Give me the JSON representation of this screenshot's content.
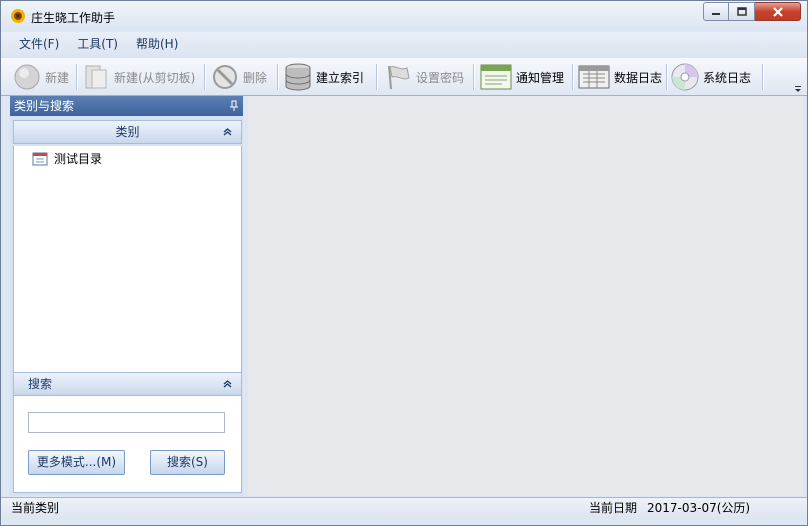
{
  "window": {
    "title": "庄生晓工作助手"
  },
  "menu": {
    "items": [
      "文件(F)",
      "工具(T)",
      "帮助(H)"
    ]
  },
  "toolbar": {
    "new_label": "新建",
    "new_from_clipboard_label": "新建(从剪切板)",
    "delete_label": "删除",
    "build_index_label": "建立索引",
    "set_password_label": "设置密码",
    "notification_label": "通知管理",
    "data_log_label": "数据日志",
    "system_log_label": "系统日志"
  },
  "left_panel": {
    "title": "类别与搜索",
    "category_header": "类别",
    "tree_items": [
      "测试目录"
    ],
    "search_header": "搜索",
    "search_value": "",
    "more_modes_label": "更多模式...(M)",
    "search_button_label": "搜索(S)"
  },
  "status": {
    "current_category_label": "当前类别",
    "current_date_label": "当前日期",
    "current_date_value": "2017-03-07(公历)"
  },
  "colors": {
    "panel_header": "#4a6fa5",
    "main_background": "#e7e9ec",
    "close_button": "#c8412d"
  }
}
